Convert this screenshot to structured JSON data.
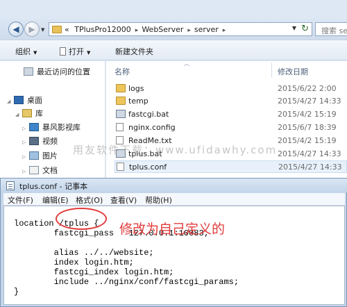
{
  "explorer": {
    "address": {
      "crumbs": [
        "TPlusPro12000",
        "WebServer",
        "server"
      ],
      "lead_chevron": "«",
      "separator": "▸",
      "search_placeholder": "搜索 se"
    },
    "toolbar": {
      "organize_label": "组织",
      "open_label": "打开",
      "new_folder_label": "新建文件夹"
    },
    "nav": {
      "recent": "最近访问的位置",
      "desktop": "桌面",
      "libraries": "库",
      "storm_video": "暴风影视库",
      "videos": "视频",
      "pictures": "图片",
      "documents": "文档"
    },
    "columns": {
      "name": "名称",
      "date": "修改日期"
    },
    "files": [
      {
        "name": "logs",
        "date": "2015/6/22 2:00",
        "icon": "folder-icon"
      },
      {
        "name": "temp",
        "date": "2015/4/27 14:33",
        "icon": "folder-icon"
      },
      {
        "name": "fastcgi.bat",
        "date": "2015/4/2 15:19",
        "icon": "bat-file-icon"
      },
      {
        "name": "nginx.config",
        "date": "2015/6/7 18:39",
        "icon": "config-file-icon"
      },
      {
        "name": "ReadMe.txt",
        "date": "2015/4/2 15:19",
        "icon": "text-file-icon"
      },
      {
        "name": "tplus.bat",
        "date": "2015/4/27 14:33",
        "icon": "bat-file-icon"
      },
      {
        "name": "tplus.conf",
        "date": "2015/4/27 14:33",
        "icon": "text-file-icon"
      }
    ],
    "watermark": "用友软件下载：www.ufidawhy.com"
  },
  "notepad": {
    "title": "tplus.conf - 记事本",
    "menu": [
      "文件(F)",
      "编辑(E)",
      "格式(O)",
      "查看(V)",
      "帮助(H)"
    ],
    "code_lines": [
      "location /tplus {",
      "        fastcgi_pass   127.0.0.1:10083;",
      "",
      "        alias ../../website;",
      "        index login.htm;",
      "        fastcgi_index login.htm;",
      "        include ../nginx/conf/fastcgi_params;",
      "}"
    ],
    "annotation": "修改为自己定义的"
  }
}
